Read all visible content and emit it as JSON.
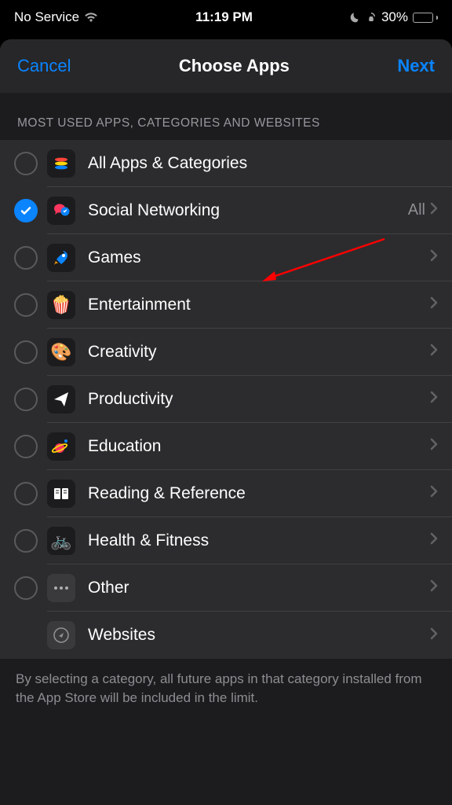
{
  "status": {
    "carrier": "No Service",
    "time": "11:19 PM",
    "battery_percent": "30%"
  },
  "nav": {
    "cancel": "Cancel",
    "title": "Choose Apps",
    "next": "Next"
  },
  "section_header": "MOST USED APPS, CATEGORIES AND WEBSITES",
  "rows": [
    {
      "label": "All Apps & Categories"
    },
    {
      "label": "Social Networking",
      "trail": "All"
    },
    {
      "label": "Games"
    },
    {
      "label": "Entertainment"
    },
    {
      "label": "Creativity"
    },
    {
      "label": "Productivity"
    },
    {
      "label": "Education"
    },
    {
      "label": "Reading & Reference"
    },
    {
      "label": "Health & Fitness"
    },
    {
      "label": "Other"
    },
    {
      "label": "Websites"
    }
  ],
  "footer": "By selecting a category, all future apps in that category installed from the App Store will be included in the limit."
}
